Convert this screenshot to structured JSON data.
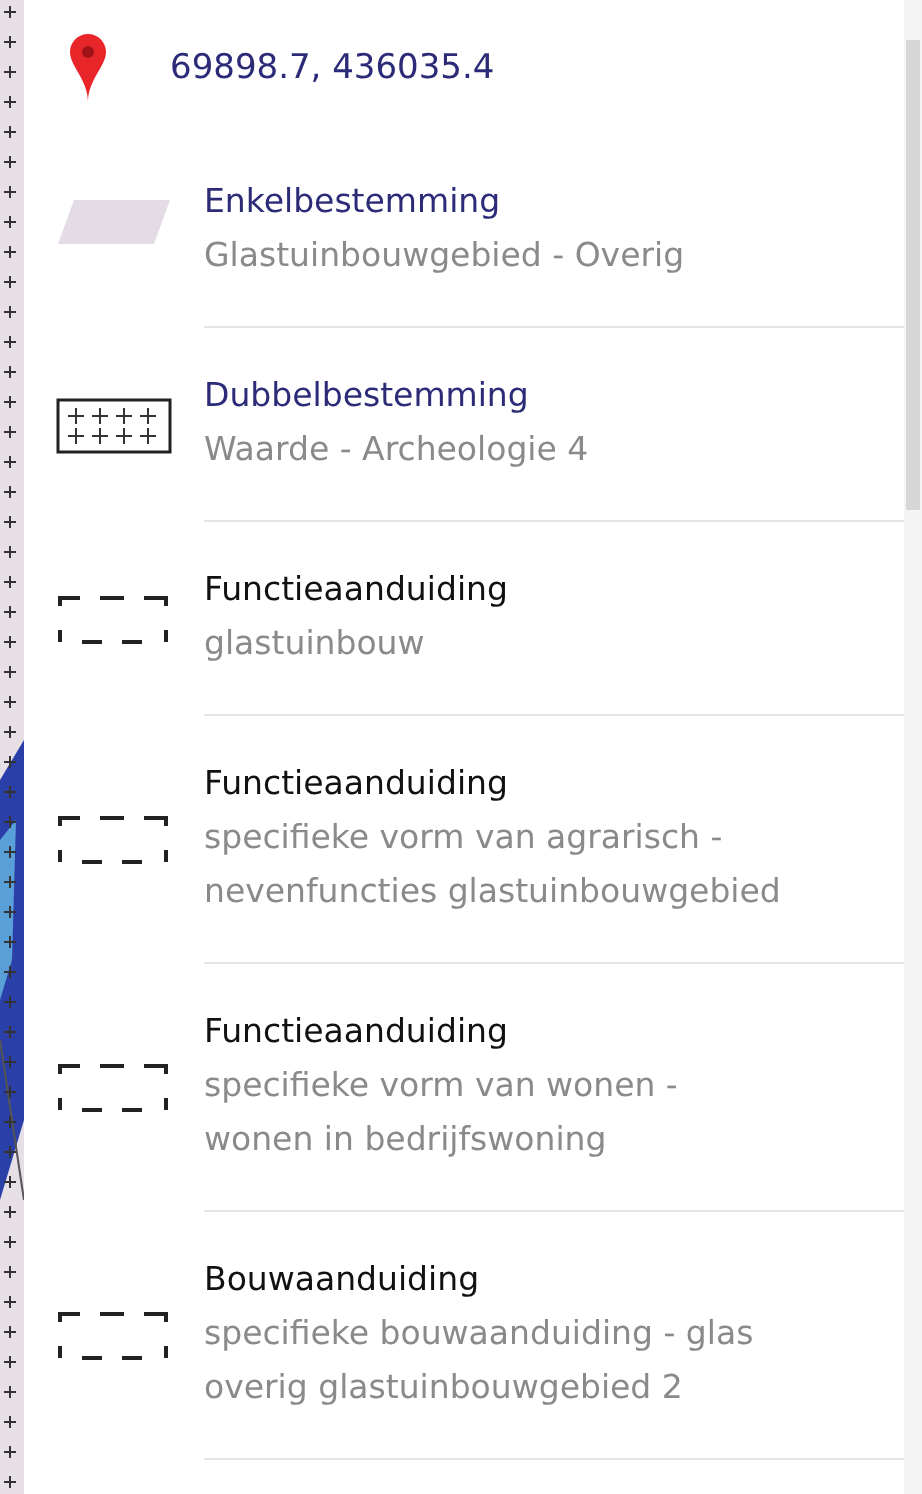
{
  "location": {
    "coordinates": "69898.7, 436035.4"
  },
  "items": [
    {
      "kind": "fill",
      "link": true,
      "title": "Enkelbestemming",
      "lines": [
        "Glastuinbouwgebied - Overig"
      ]
    },
    {
      "kind": "grid",
      "link": true,
      "title": "Dubbelbestemming",
      "lines": [
        "Waarde - Archeologie 4"
      ]
    },
    {
      "kind": "dashed",
      "link": false,
      "title": "Functieaanduiding",
      "lines": [
        "glastuinbouw"
      ]
    },
    {
      "kind": "dashed",
      "link": false,
      "title": "Functieaanduiding",
      "lines": [
        "specifieke vorm van agrarisch -",
        "nevenfuncties glastuinbouwgebied"
      ]
    },
    {
      "kind": "dashed",
      "link": false,
      "title": "Functieaanduiding",
      "lines": [
        "specifieke vorm van wonen -",
        "wonen in bedrijfswoning"
      ]
    },
    {
      "kind": "dashed",
      "link": false,
      "title": "Bouwaanduiding",
      "lines": [
        "specifieke bouwaanduiding - glas",
        "overig glastuinbouwgebied 2"
      ]
    }
  ]
}
